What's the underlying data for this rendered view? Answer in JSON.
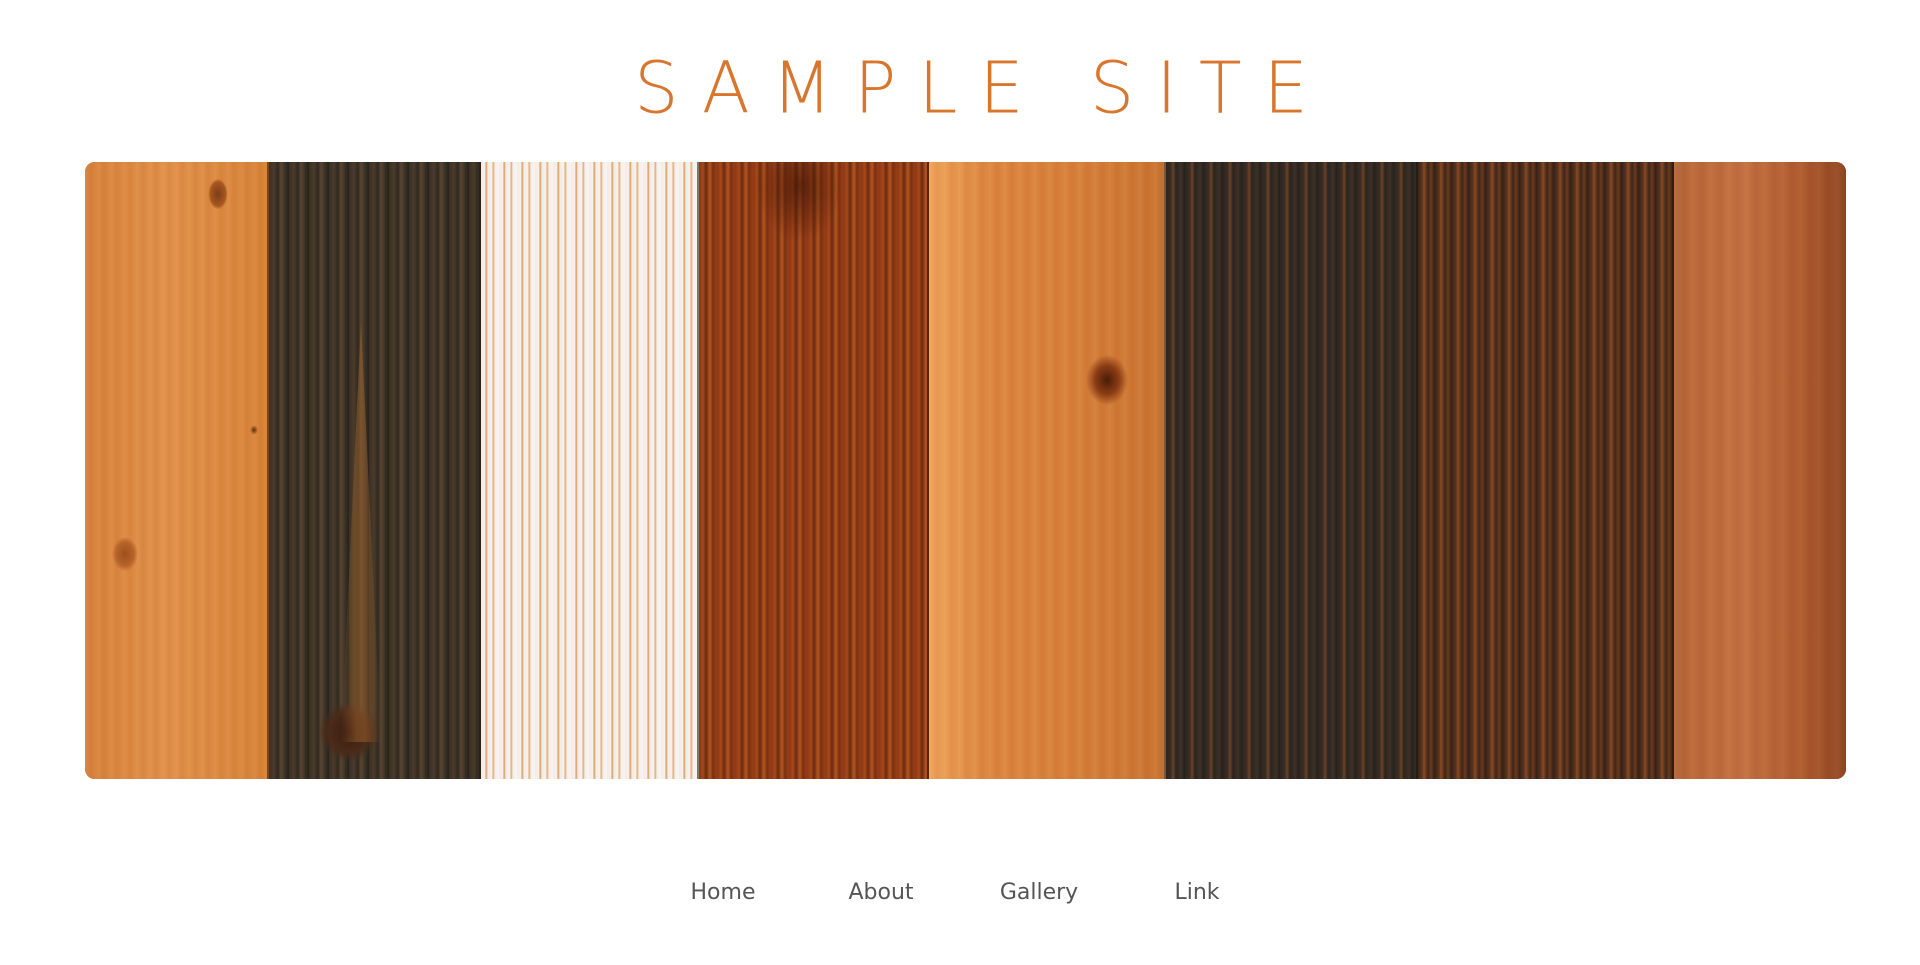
{
  "site": {
    "title": "SAMPLE SITE",
    "title_color": "#d9762e"
  },
  "hero": {
    "description": "wood planks header image"
  },
  "nav": {
    "items": [
      {
        "label": "Home"
      },
      {
        "label": "About"
      },
      {
        "label": "Gallery"
      },
      {
        "label": "Link"
      }
    ],
    "text_color": "#555555"
  }
}
